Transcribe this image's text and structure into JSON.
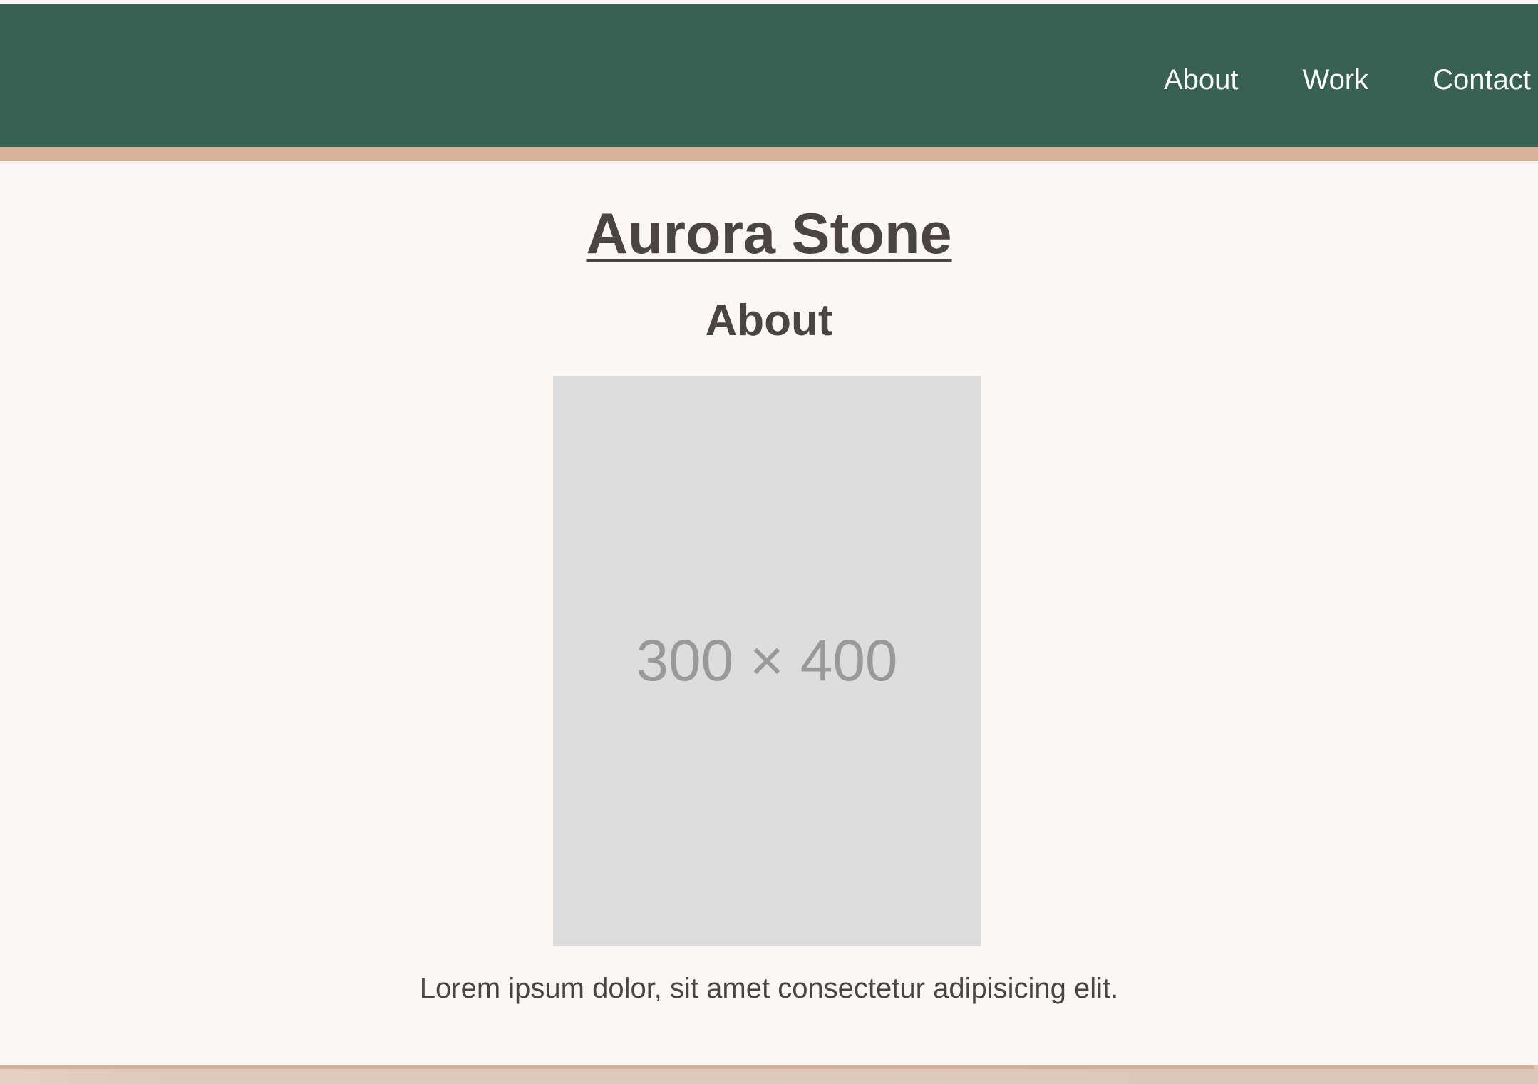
{
  "header": {
    "nav": [
      {
        "label": "About"
      },
      {
        "label": "Work"
      },
      {
        "label": "Contact"
      }
    ]
  },
  "main": {
    "title": "Aurora Stone",
    "section_heading": "About",
    "image_placeholder": "300 × 400",
    "paragraph": "Lorem ipsum dolor, sit amet consectetur adipisicing elit."
  },
  "colors": {
    "header_bg": "#376153",
    "accent": "#d8b39a",
    "page_bg": "#fbf7f4",
    "text": "#4a4542"
  }
}
